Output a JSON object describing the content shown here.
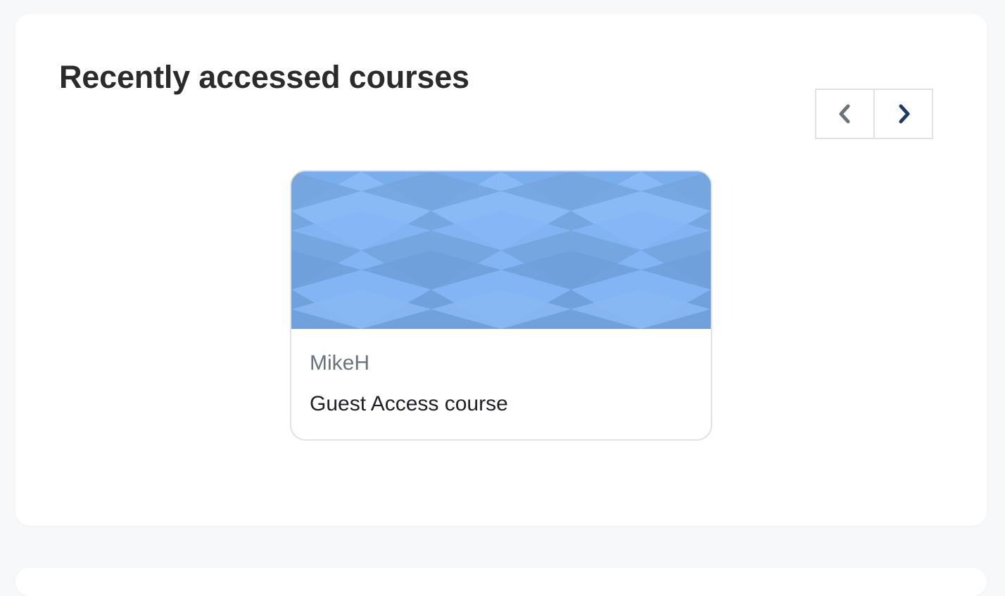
{
  "block": {
    "title": "Recently accessed courses"
  },
  "paging": {
    "prev_icon": "chevron-left-icon",
    "next_icon": "chevron-right-icon"
  },
  "courses": [
    {
      "category": "MikeH",
      "name": "Guest Access course",
      "image_pattern": "blue-triangle-pattern"
    }
  ],
  "colors": {
    "page_background": "#f7f8f9",
    "card_border": "#dee2e6",
    "title_text": "#2b2b2b",
    "category_text": "#6a737b",
    "course_name_text": "#1d2125",
    "next_arrow": "#1d3a66",
    "prev_arrow": "#6a737b",
    "pattern_base": "#7aaded"
  }
}
